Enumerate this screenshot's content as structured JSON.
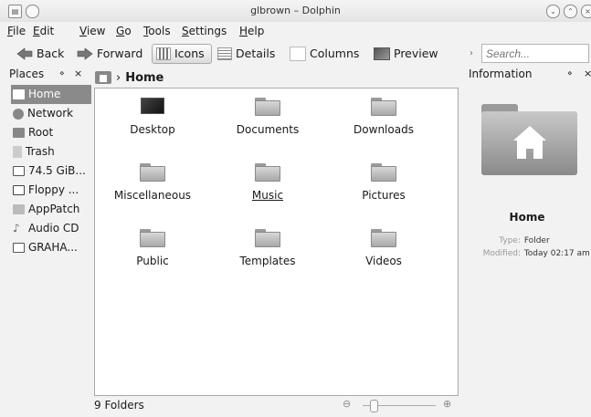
{
  "window": {
    "title": "glbrown – Dolphin"
  },
  "menu": [
    {
      "label": "File",
      "key": "F",
      "rest": "ile"
    },
    {
      "label": "Edit",
      "key": "E",
      "rest": "dit"
    },
    {
      "label": "View",
      "key": "V",
      "rest": "iew"
    },
    {
      "label": "Go",
      "key": "G",
      "rest": "o"
    },
    {
      "label": "Tools",
      "key": "T",
      "rest": "ools"
    },
    {
      "label": "Settings",
      "key": "S",
      "rest": "ettings"
    },
    {
      "label": "Help",
      "key": "H",
      "rest": "elp"
    }
  ],
  "toolbar": {
    "back_label": "Back",
    "forward_label": "Forward",
    "icons_label": "Icons",
    "details_label": "Details",
    "columns_label": "Columns",
    "preview_label": "Preview",
    "search_placeholder": "Search..."
  },
  "places": {
    "title": "Places",
    "items": [
      "Home",
      "Network",
      "Root",
      "Trash",
      "74.5 GiB...",
      "Floppy ...",
      "AppPatch",
      "Audio CD",
      "GRAHA..."
    ],
    "selected": "Home"
  },
  "breadcrumb": {
    "current": "Home"
  },
  "files": [
    "Desktop",
    "Documents",
    "Downloads",
    "Miscellaneous",
    "Music",
    "Pictures",
    "Public",
    "Templates",
    "Videos"
  ],
  "status": {
    "text": "9 Folders"
  },
  "info": {
    "title": "Information",
    "name": "Home",
    "type_label": "Type:",
    "type_value": "Folder",
    "modified_label": "Modified:",
    "modified_value": "Today 02:17 am"
  }
}
